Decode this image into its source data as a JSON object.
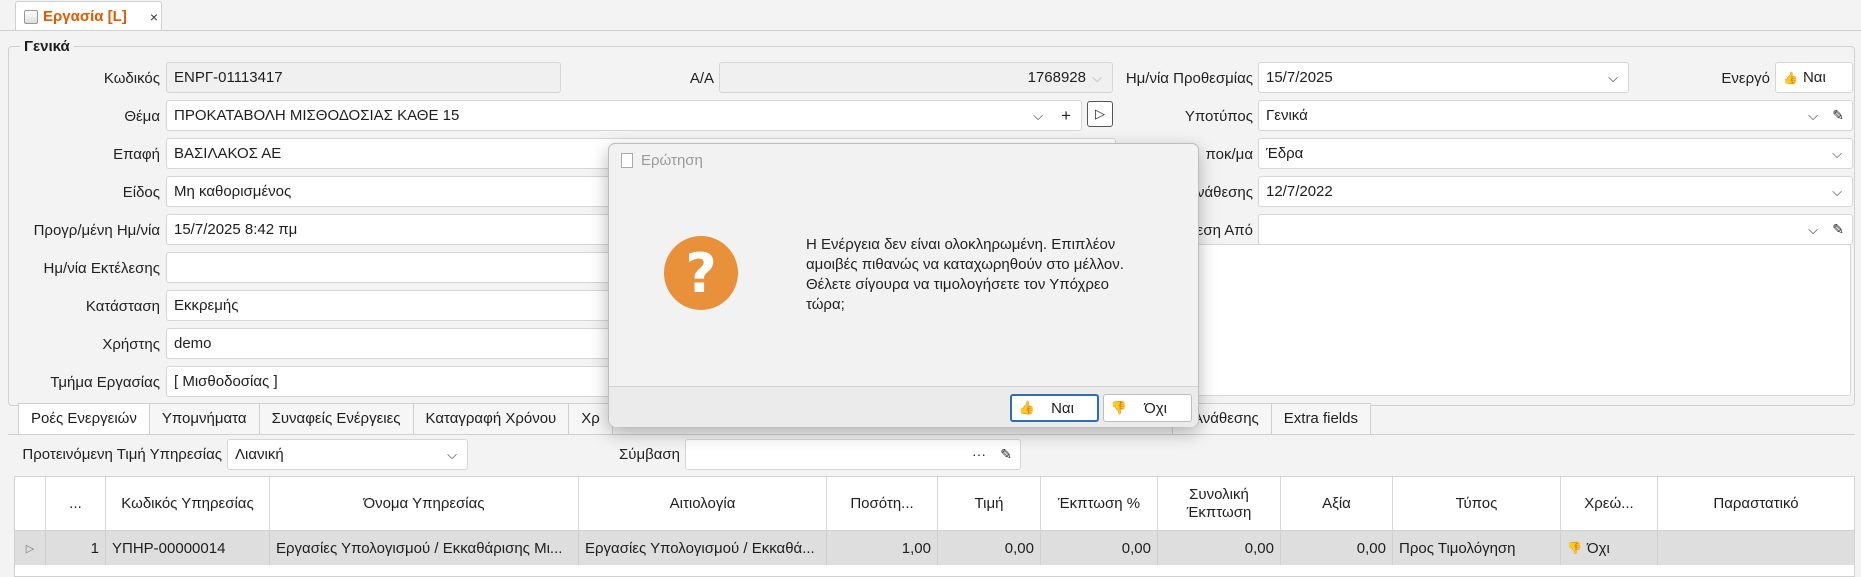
{
  "doc_tab": {
    "title": "Εργασία [L]",
    "close": "×",
    "icon": "document-icon"
  },
  "group": {
    "title": "Γενικά"
  },
  "form": {
    "code_label": "Κωδικός",
    "code_value": "ΕΝΡΓ-01113417",
    "aa_label": "Α/Α",
    "aa_value": "1768928",
    "deadline_label": "Ημ/νία Προθεσμίας",
    "deadline_value": "15/7/2025",
    "active_label": "Ενεργό",
    "active_value": "Ναι",
    "subject_label": "Θέμα",
    "subject_value": "ΠΡΟΚΑΤΑΒΟΛΗ ΜΙΣΘΟΔΟΣΙΑΣ ΚΑΘΕ 15",
    "subtype_label": "Υποτύπος",
    "subtype_value": "Γενικά",
    "contact_label": "Επαφή",
    "contact_value": "ΒΑΣΙΛΑΚΟΣ ΑΕ",
    "branch_label": "ποκ/μα",
    "branch_value": "Έδρα",
    "kind_label": "Είδος",
    "kind_value": "Μη καθορισμένος",
    "assign_date_label": "νάθεσης",
    "assign_date_value": "12/7/2022",
    "scheduled_label": "Προγρ/μένη Ημ/νία",
    "scheduled_value": "15/7/2025 8:42 πμ",
    "assigned_from_label": "εση Από",
    "assigned_from_value": "",
    "exec_date_label": "Ημ/νία Εκτέλεσης",
    "exec_date_value": "",
    "status_label": "Κατάσταση",
    "status_value": "Εκκρεμής",
    "user_label": "Χρήστης",
    "user_value": "demo",
    "dept_label": "Τμήμα Εργασίας",
    "dept_value": "[ Μισθοδοσίας ]"
  },
  "tabs": [
    "Ροές Ενεργειών",
    "Υπομνήματα",
    "Συναφείς Ενέργειες",
    "Καταγραφή Χρόνου",
    "Χρ"
  ],
  "tabs_right": [
    "Ανάθεσης",
    "Extra fields"
  ],
  "services": {
    "price_label": "Προτεινόμενη Τιμή Υπηρεσίας",
    "price_value": "Λιανική",
    "contract_label": "Σύμβαση",
    "contract_value": "",
    "columns": [
      "...",
      "Κωδικός Υπηρεσίας",
      "Όνομα Υπηρεσίας",
      "Αιτιολογία",
      "Ποσότη...",
      "Τιμή",
      "Έκπτωση %",
      "Συνολική Έκπτωση",
      "Αξία",
      "Τύπος",
      "Χρεώ...",
      "Παραστατικό"
    ],
    "rows": [
      {
        "index": "1",
        "code": "ΥΠΗΡ-00000014",
        "name": "Εργασίες Υπολογισμού / Εκκαθάρισης Μι...",
        "reason": "Εργασίες Υπολογισμού / Εκκαθά...",
        "qty": "1,00",
        "price": "0,00",
        "disc_pct": "0,00",
        "disc_total": "0,00",
        "value": "0,00",
        "type": "Προς Τιμολόγηση",
        "charge": "Όχι",
        "doc": ""
      }
    ]
  },
  "dialog": {
    "title": "Ερώτηση",
    "icon": "question-icon",
    "message": "Η Ενέργεια δεν είναι ολοκληρωμένη. Επιπλέον αμοιβές πιθανώς να καταχωρηθούν στο μέλλον. Θέλετε σίγουρα να τιμολογήσετε τον Υπόχρεο τώρα;",
    "yes_label": "Ναι",
    "no_label": "Όχι"
  },
  "colors": {
    "accent": "#e05a00",
    "question": "#e8903a",
    "primary_border": "#2b6fb4",
    "thumb_up": "#6aa84f",
    "thumb_down": "#c0392b"
  }
}
